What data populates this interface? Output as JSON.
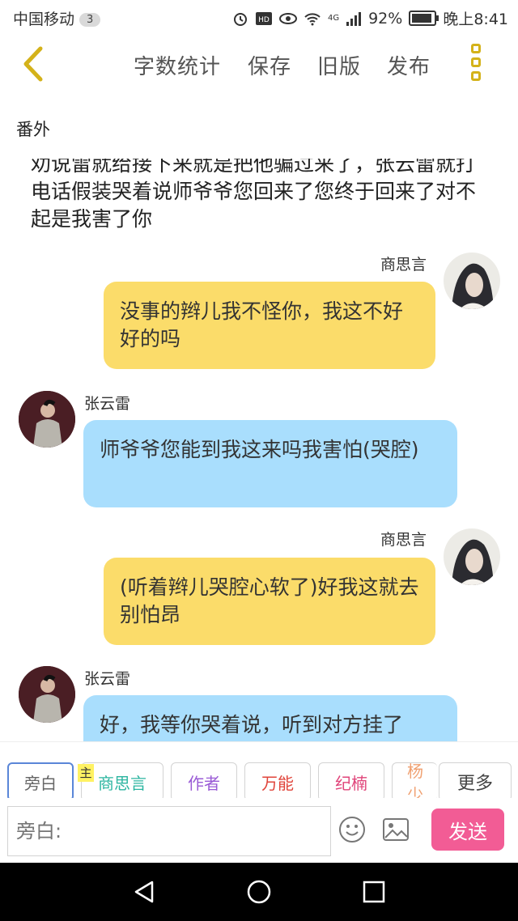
{
  "status_bar": {
    "carrier": "中国移动",
    "notification_count": "3",
    "network": "4G",
    "battery": "92%",
    "battery_level": 0.92,
    "time": "晚上8:41"
  },
  "toolbar": {
    "word_count": "字数统计",
    "save": "保存",
    "old_version": "旧版",
    "publish": "发布"
  },
  "chapter": {
    "title": "番外"
  },
  "narration": "劝说雷就给接下来就是把他骗过来了，张云雷就打电话假装哭着说师爷爷您回来了您终于回来了对不起是我害了你",
  "messages": [
    {
      "speaker": "商思言",
      "text": "没事的辫儿我不怪你，我这不好好的吗"
    },
    {
      "speaker": "张云雷",
      "text": "师爷爷您能到我这来吗我害怕(哭腔)"
    },
    {
      "speaker": "商思言",
      "text": "(听着辫儿哭腔心软了)好我这就去别怕昂"
    },
    {
      "speaker": "张云雷",
      "text": "好，我等你哭着说，听到对方挂了"
    }
  ],
  "roles": {
    "main_tag": "主",
    "items": [
      {
        "label": "旁白",
        "color": "#666666"
      },
      {
        "label": "商思言",
        "color": "#2bb5a0"
      },
      {
        "label": "作者",
        "color": "#9a5bd6"
      },
      {
        "label": "万能",
        "color": "#e0443a"
      },
      {
        "label": "纪楠",
        "color": "#e0447a"
      },
      {
        "label": "杨少",
        "color": "#f0a070"
      }
    ],
    "more": "更多"
  },
  "input": {
    "placeholder": "旁白:"
  },
  "send": "发送"
}
